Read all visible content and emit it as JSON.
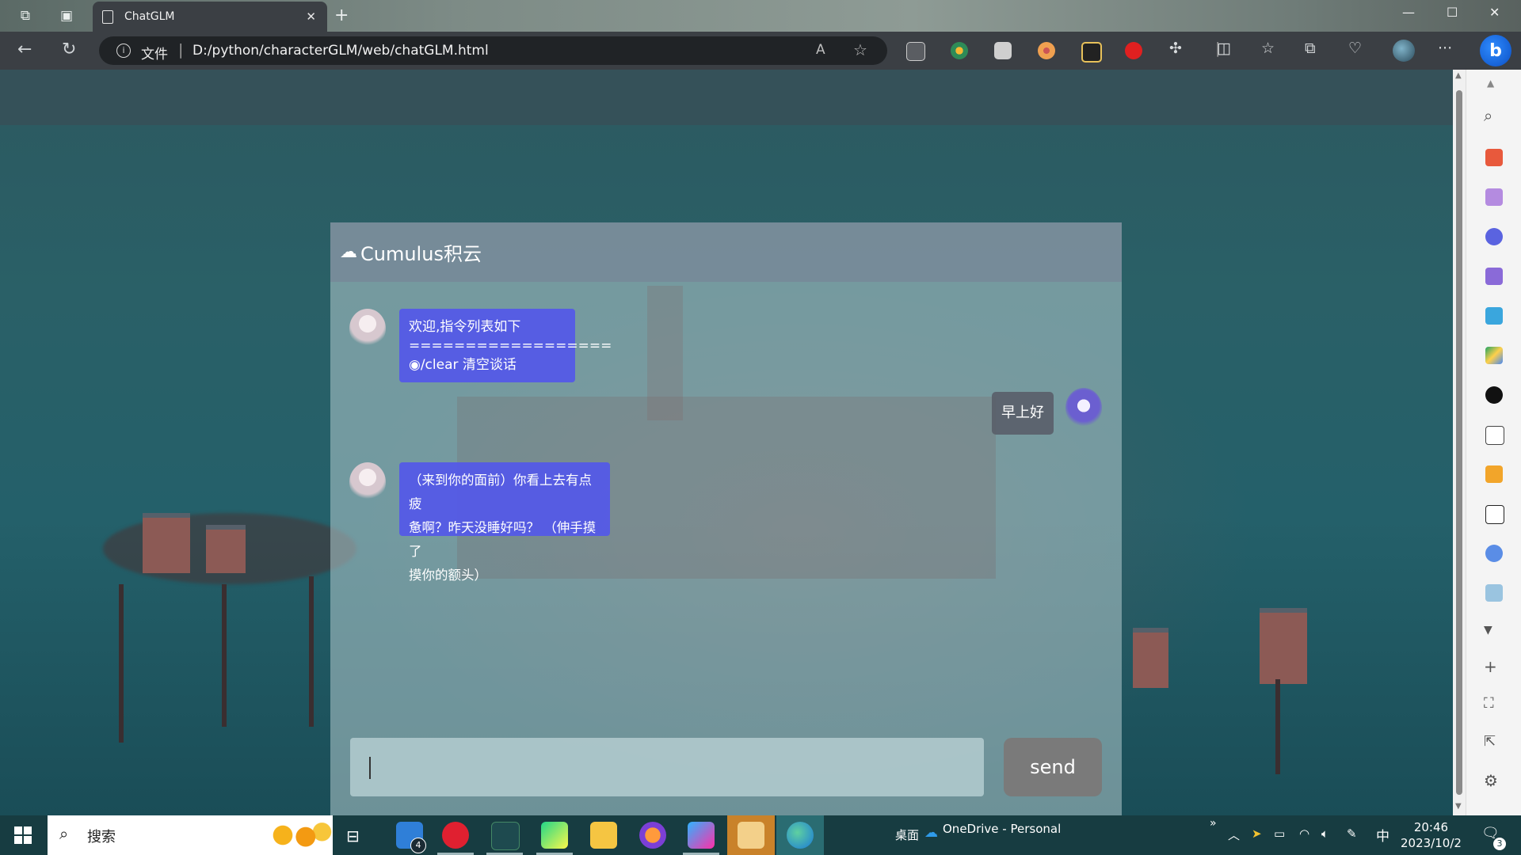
{
  "browser": {
    "tab_title": "ChatGLM",
    "address_scheme": "文件",
    "address_url": "D:/python/characterGLM/web/chatGLM.html",
    "read_aloud": "A",
    "new_tab": "+",
    "more": "···"
  },
  "chat": {
    "brand": "Cumulus积云",
    "messages": [
      {
        "sender": "bot",
        "lines": [
          "欢迎,指令列表如下",
          "==================",
          "◉/clear 清空谈话"
        ]
      },
      {
        "sender": "user",
        "text": "早上好"
      },
      {
        "sender": "bot",
        "lines": [
          "（来到你的面前）你看上去有点疲",
          "惫啊？昨天没睡好吗？ （伸手摸了",
          "摸你的额头）"
        ]
      }
    ],
    "input_value": "",
    "send_label": "send"
  },
  "taskbar": {
    "search_placeholder": "搜索",
    "todo_badge": "4",
    "desktop_label": "桌面",
    "onedrive_label": "OneDrive - Personal",
    "ime": "中",
    "time": "20:46",
    "date": "2023/10/2",
    "notification_badge": "3"
  },
  "colors": {
    "bot_bubble": "#5458e8",
    "user_bubble": "#5a606a",
    "chat_header": "#768898",
    "send_button": "#7a7a7a",
    "taskbar": "#173c41"
  }
}
